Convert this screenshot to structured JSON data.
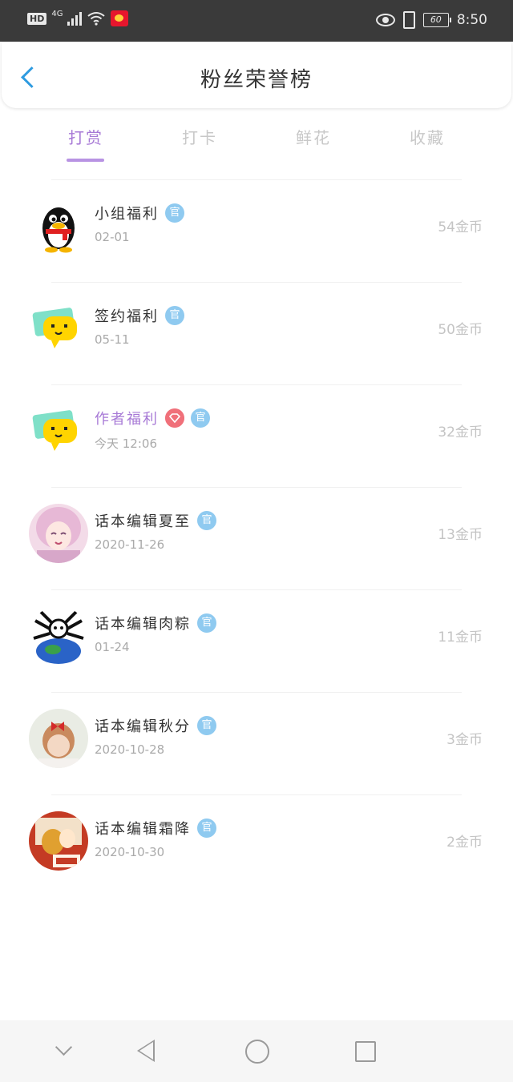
{
  "status_bar": {
    "hd": "HD",
    "network": "4G",
    "battery": "60",
    "time": "8:50"
  },
  "header": {
    "title": "粉丝荣誉榜"
  },
  "tabs": [
    {
      "label": "打赏",
      "active": true
    },
    {
      "label": "打卡",
      "active": false
    },
    {
      "label": "鲜花",
      "active": false
    },
    {
      "label": "收藏",
      "active": false
    }
  ],
  "badges": {
    "official": "官"
  },
  "rows": [
    {
      "name": "小组福利",
      "date": "02-01",
      "coins": "54金币",
      "avatar": "penguin-avatar"
    },
    {
      "name": "签约福利",
      "date": "05-11",
      "coins": "50金币",
      "avatar": "speech-bubble-avatar"
    },
    {
      "name": "作者福利",
      "date": "今天 12:06",
      "coins": "32金币",
      "avatar": "speech-bubble-avatar",
      "author_badge": true
    },
    {
      "name": "话本编辑夏至",
      "date": "2020-11-26",
      "coins": "13金币",
      "avatar": "anime-girl-avatar"
    },
    {
      "name": "话本编辑肉粽",
      "date": "01-24",
      "coins": "11金币",
      "avatar": "globe-creature-avatar"
    },
    {
      "name": "话本编辑秋分",
      "date": "2020-10-28",
      "coins": "3金币",
      "avatar": "doll-avatar"
    },
    {
      "name": "话本编辑霜降",
      "date": "2020-10-30",
      "coins": "2金币",
      "avatar": "cartoon-avatar"
    }
  ],
  "colors": {
    "accent_purple": "#a779d6",
    "back_blue": "#2e9be0",
    "official_badge": "#8fcaf0",
    "author_badge": "#f0707a"
  }
}
